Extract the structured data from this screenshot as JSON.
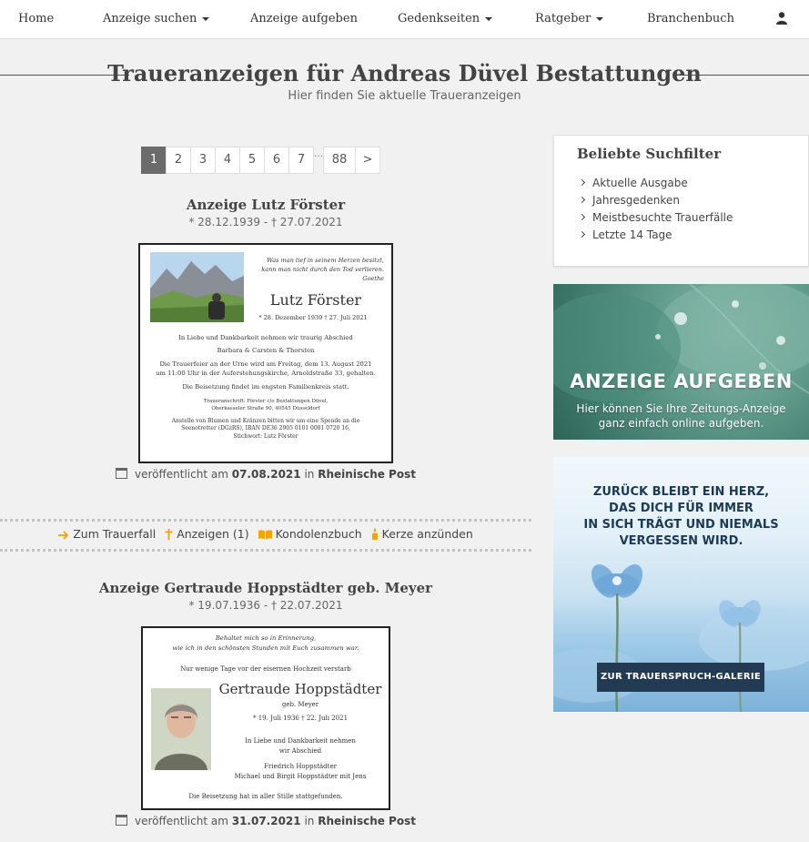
{
  "nav": {
    "home": "Home",
    "search": "Anzeige suchen",
    "submit": "Anzeige aufgeben",
    "memorial": "Gedenkseiten",
    "guide": "Ratgeber",
    "directory": "Branchenbuch"
  },
  "header": {
    "title": "Traueranzeigen für Andreas Düvel Bestattungen",
    "subtitle": "Hier finden Sie aktuelle Traueranzeigen"
  },
  "pagination": {
    "pages": [
      "1",
      "2",
      "3",
      "4",
      "5",
      "6",
      "7"
    ],
    "ellipsis": "…",
    "last": "88",
    "next": ">"
  },
  "entries": [
    {
      "title": "Anzeige Lutz Förster",
      "dates": "* 28.12.1939 - † 27.07.2021",
      "notice": {
        "quote1": "Was man tief in seinem Herzen besitzt,",
        "quote2": "kann man nicht durch den Tod verlieren.",
        "quote_author": "Goethe",
        "name": "Lutz Förster",
        "life": "* 28. Dezember 1939    † 27. Juli 2021",
        "line1": "In Liebe und Dankbarkeit nehmen wir traurig Abschied",
        "line2": "Barbara & Carsten & Thorsten",
        "line3": "Die Trauerfeier an der Urne wird am Freitag, dem 13. August 2021",
        "line4": "um 11:00 Uhr in der Auferstehungskirche, Arnoldstraße 33, gehalten.",
        "line5": "Die Beisetzung findet im engsten Familienkreis statt.",
        "line6": "Traueranschrift: Förster c/o Bestattungen Düvel,",
        "line7": "Oberkasseler Straße 90, 40545 Düsseldorf",
        "line8": "Anstelle von Blumen und Kränzen bitten wir um eine Spende an die",
        "line9": "Seenotretter (DGzRS), IBAN DE36 2905 0101 0001 0720 16,",
        "line10": "Stichwort: Lutz Förster"
      },
      "published_prefix": "veröffentlicht am",
      "published_date": "07.08.2021",
      "published_in": "in",
      "newspaper": "Rheinische Post"
    },
    {
      "title": "Anzeige Gertraude Hoppstädter geb. Meyer",
      "dates": "* 19.07.1936 - † 22.07.2021",
      "notice": {
        "quote1": "Behaltet mich so in Erinnerung,",
        "quote2": "wie ich in den schönsten Stunden mit Euch zusammen war.",
        "line0": "Nur wenige Tage vor der eisernen Hochzeit verstarb",
        "name": "Gertraude Hoppstädter",
        "born_name": "geb. Meyer",
        "life": "* 19. Juli 1936    † 22. Juli 2021",
        "line1": "In Liebe und Dankbarkeit nehmen",
        "line2": "wir Abschied",
        "line3": "Friedrich Hoppstädter",
        "line4": "Michael und Birgit Hoppstädter mit Jens",
        "line5": "Die Beisetzung hat in aller Stille stattgefunden."
      },
      "published_prefix": "veröffentlicht am",
      "published_date": "31.07.2021",
      "published_in": "in",
      "newspaper": "Rheinische Post"
    }
  ],
  "actions": {
    "case": "Zum Trauerfall",
    "notices": "Anzeigen (1)",
    "condolence": "Kondolenzbuch",
    "candle": "Kerze anzünden"
  },
  "sidebar": {
    "filter_title": "Beliebte Suchfilter",
    "filters": [
      "Aktuelle Ausgabe",
      "Jahresgedenken",
      "Meistbesuchte Trauerfälle",
      "Letzte 14 Tage"
    ],
    "banner1_title": "ANZEIGE AUFGEBEN",
    "banner1_sub1": "Hier können Sie Ihre Zeitungs-Anzeige",
    "banner1_sub2": "ganz einfach online aufgeben.",
    "banner2_quote1": "ZURÜCK BLEIBT EIN HERZ,",
    "banner2_quote2": "DAS DICH FÜR IMMER",
    "banner2_quote3": "IN SICH TRÄGT UND NIEMALS",
    "banner2_quote4": "VERGESSEN WIRD.",
    "banner2_button": "ZUR TRAUERSPRUCH-GALERIE"
  },
  "colors": {
    "accent_arrow": "#f0a500",
    "accent_cross": "#f0a500",
    "banner_button": "#223a52"
  }
}
